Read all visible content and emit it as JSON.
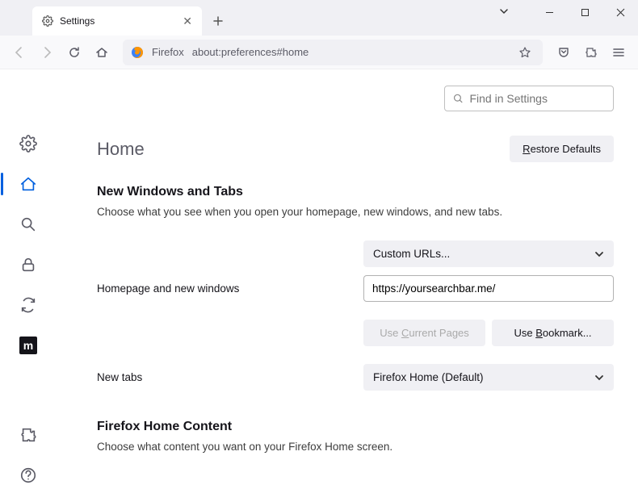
{
  "tab": {
    "title": "Settings"
  },
  "urlbar": {
    "label": "Firefox",
    "url": "about:preferences#home"
  },
  "search": {
    "placeholder": "Find in Settings"
  },
  "page": {
    "title": "Home",
    "restore": "Restore Defaults",
    "section1_title": "New Windows and Tabs",
    "section1_desc": "Choose what you see when you open your homepage, new windows, and new tabs.",
    "homepage_label": "Homepage and new windows",
    "homepage_select": "Custom URLs...",
    "homepage_url": "https://yoursearchbar.me/",
    "use_current": "Use Current Pages",
    "use_bookmark": "Use Bookmark...",
    "newtabs_label": "New tabs",
    "newtabs_select": "Firefox Home (Default)",
    "section2_title": "Firefox Home Content",
    "section2_desc": "Choose what content you want on your Firefox Home screen."
  }
}
